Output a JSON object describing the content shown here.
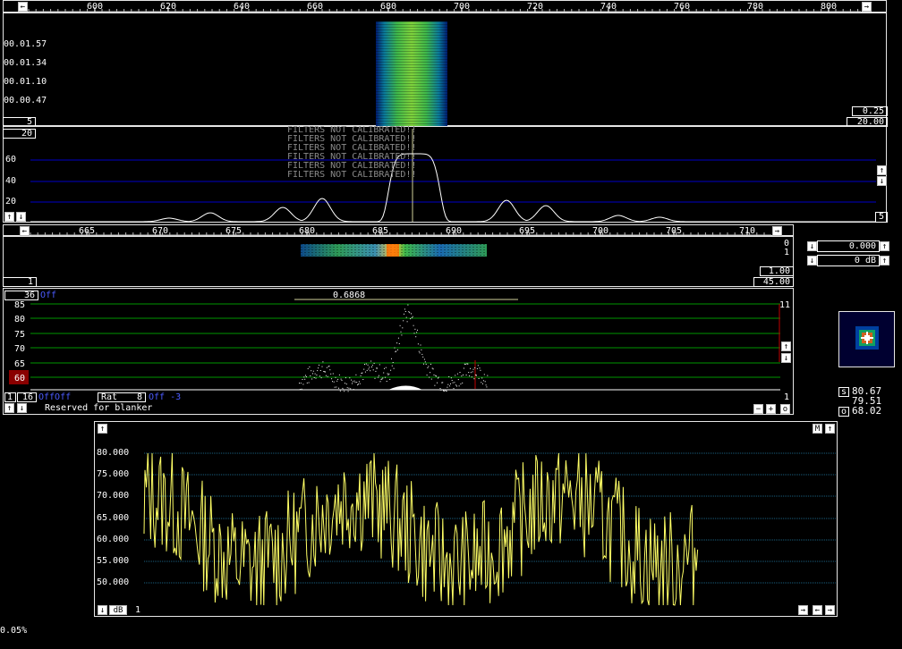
{
  "colors": {
    "accent_blue": "#3a4bff",
    "trace_yellow": "#ffff66",
    "grid_blue": "#0000c8",
    "grid_green": "#009600",
    "alarm_red": "#c00000"
  },
  "top_scale": {
    "ticks": [
      "600",
      "620",
      "640",
      "660",
      "680",
      "700",
      "720",
      "740",
      "760",
      "780",
      "800"
    ]
  },
  "waterfall": {
    "times": [
      "00.01.57",
      "00.01.34",
      "00.01.10",
      "00.00.47"
    ],
    "left_box": "5",
    "right_top": "0.25",
    "right_bottom": "20.00"
  },
  "spectrum": {
    "top_box": "20",
    "grid_labels": [
      "60",
      "40",
      "20"
    ],
    "warning_lines": [
      "FILTERS NOT CALIBRATED!!",
      "FILTERS NOT CALIBRATED!!",
      "FILTERS NOT CALIBRATED!!",
      "FILTERS NOT CALIBRATED!!",
      "FILTERS NOT CALIBRATED!!",
      "FILTERS NOT CALIBRATED!!"
    ],
    "right_box": "5"
  },
  "zoom_scale": {
    "ticks": [
      "665",
      "670",
      "675",
      "680",
      "685",
      "690",
      "695",
      "700",
      "705",
      "710"
    ]
  },
  "zoom_waterfall": {
    "right_small_top": "0",
    "right_small_bottom": "1",
    "left_box": "1",
    "right_box_top": "1.00",
    "right_box_bottom": "45.00"
  },
  "side_controls": {
    "row1_value": "0.000",
    "row2_value": "0 dB"
  },
  "baseband": {
    "top_box": "36",
    "off_label": "Off",
    "freq_label": "0.6868",
    "grid_labels": [
      "85",
      "80",
      "75",
      "70",
      "65",
      "60"
    ],
    "right_top": "11",
    "bottom_box1": "1",
    "bottom_box2": "16",
    "off_off": "OffOff",
    "rat_label": "Rat",
    "rat_value": "8",
    "off_minus": "Off -3",
    "reserved": "Reserved for blanker",
    "right_one": "1",
    "btn_minus": "−",
    "btn_plus": "+",
    "btn_o": "o"
  },
  "constellation": {
    "values": [
      {
        "key": "s",
        "val": "80.67"
      },
      {
        "key": "",
        "val": "79.51"
      },
      {
        "key": "o",
        "val": "68.02"
      }
    ]
  },
  "meter": {
    "y_labels": [
      "80.000",
      "75.000",
      "70.000",
      "65.000",
      "60.000",
      "55.000",
      "50.000"
    ],
    "m_btn": "M",
    "db_btn": "dB",
    "bottom_value": "1"
  },
  "status": {
    "cpu": "0.05%"
  }
}
